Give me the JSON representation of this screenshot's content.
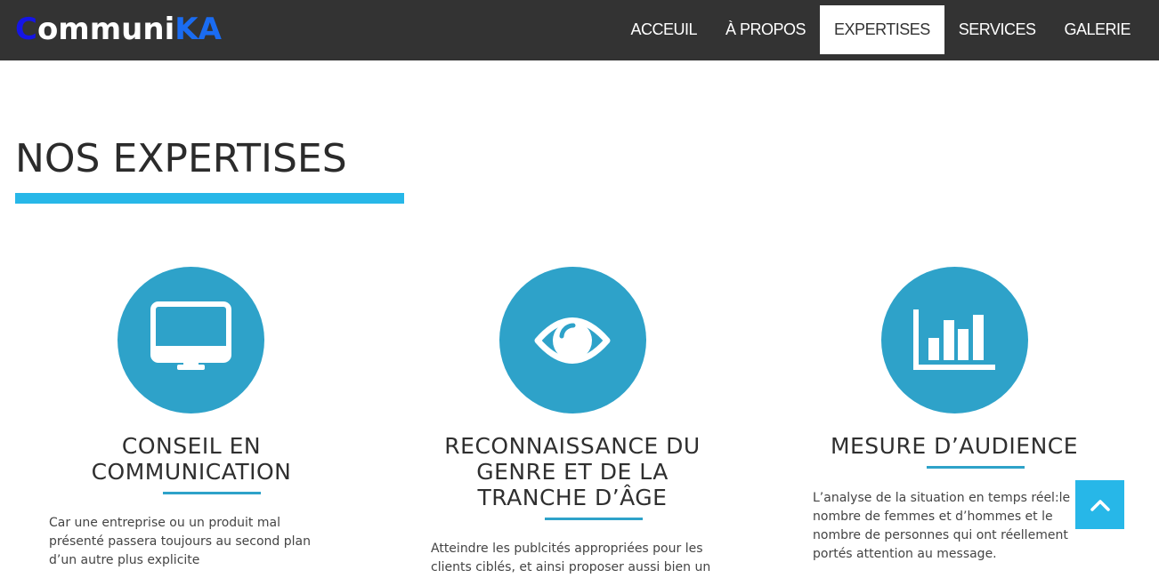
{
  "header": {
    "logo": {
      "first": "C",
      "middle": "ommuni",
      "last": "KA"
    },
    "nav": [
      {
        "label": "ACCEUIL",
        "active": false
      },
      {
        "label": "À PROPOS",
        "active": false
      },
      {
        "label": "EXPERTISES",
        "active": true
      },
      {
        "label": "SERVICES",
        "active": false
      },
      {
        "label": "GALERIE",
        "active": false
      }
    ]
  },
  "section": {
    "title": "NOS EXPERTISES",
    "accent_color": "#27b7e8",
    "circle_color": "#2ea2c9"
  },
  "cards": [
    {
      "icon": "monitor-icon",
      "title_lines": [
        "CONSEIL EN",
        "COMMUNICATION"
      ],
      "text_lines": [
        "Car une entreprise ou un produit mal",
        "présenté passera toujours au second plan",
        "d’un autre plus explicite"
      ]
    },
    {
      "icon": "eye-icon",
      "title_lines": [
        "RECONNAISSANCE DU",
        "GENRE ET DE LA",
        "TRANCHE D’ÂGE"
      ],
      "text_lines": [
        "Atteindre les publcités appropriées pour les",
        "clients ciblés, et ainsi proposer aussi bien un"
      ]
    },
    {
      "icon": "bar-chart-icon",
      "title_lines": [
        "MESURE D’AUDIENCE"
      ],
      "text_lines": [
        "L’analyse de la situation en temps réel:le",
        "nombre de femmes et d’hommes et le",
        "nombre de personnes qui ont réellement",
        "portés attention au message."
      ]
    }
  ],
  "scroll_top": {
    "icon": "chevron-up-icon"
  }
}
